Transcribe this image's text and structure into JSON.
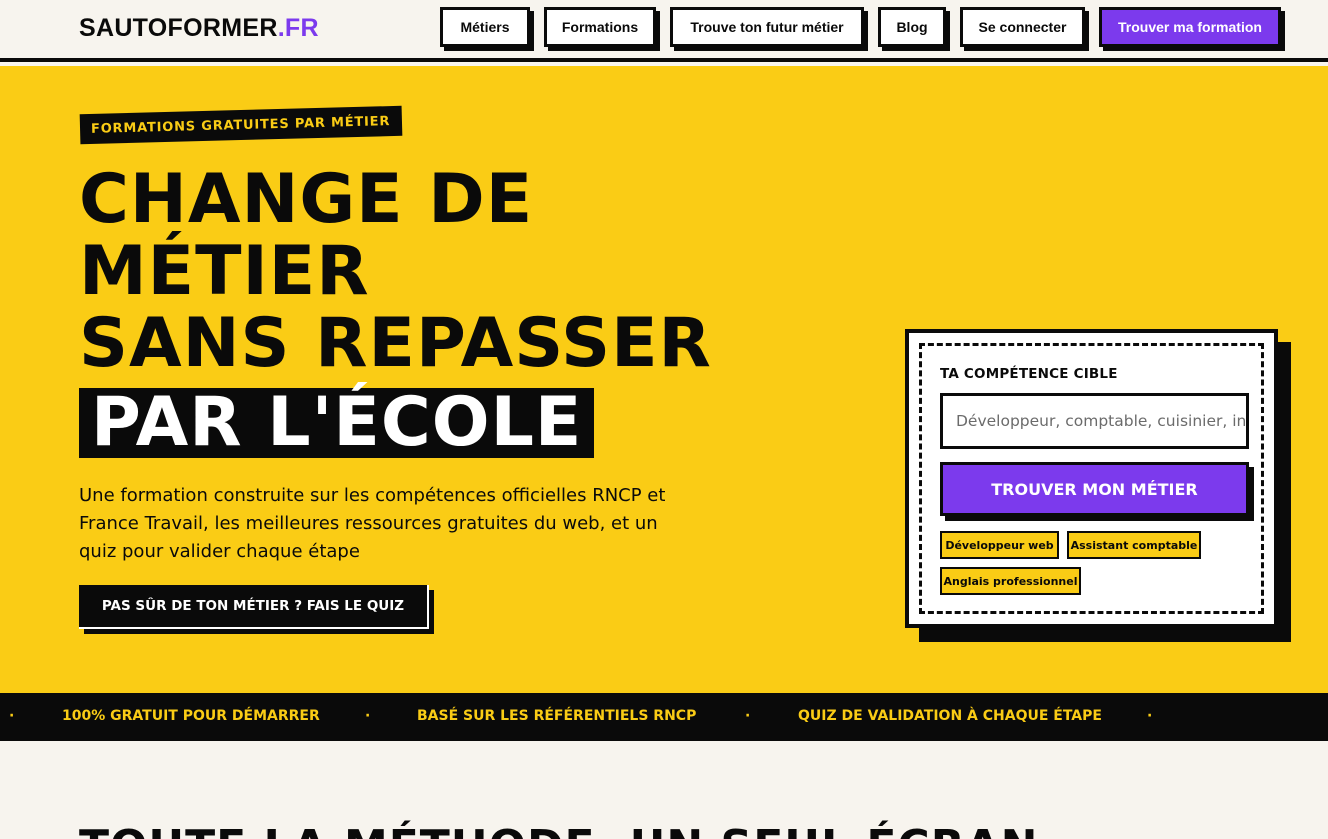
{
  "header": {
    "logo_main": "SAUTOFORMER",
    "logo_accent": ".FR",
    "nav": [
      {
        "label": "Métiers"
      },
      {
        "label": "Formations"
      },
      {
        "label": "Trouve ton futur métier"
      },
      {
        "label": "Blog"
      },
      {
        "label": "Se connecter"
      },
      {
        "label": "Trouver ma formation"
      }
    ]
  },
  "hero": {
    "tag": "FORMATIONS GRATUITES PAR MÉTIER",
    "headline": {
      "line1": "CHANGE DE",
      "line2": "MÉTIER",
      "line3": "SANS REPASSER",
      "line4": "PAR L'ÉCOLE"
    },
    "lead": "Une formation construite sur les compétences officielles RNCP et France Travail, les meilleures ressources gratuites du web, et un quiz pour valider chaque étape",
    "quiz_button": "PAS SÛR DE TON MÉTIER ? FAIS LE QUIZ"
  },
  "search_card": {
    "label": "TA COMPÉTENCE CIBLE",
    "input_value": "",
    "input_placeholder": "Développeur, comptable, cuisinier, infi",
    "button": "TROUVER MON MÉTIER",
    "chips": [
      {
        "label": "Développeur web"
      },
      {
        "label": "Assistant comptable"
      },
      {
        "label": "Anglais professionnel"
      }
    ]
  },
  "marquee": {
    "separator": "·",
    "items": [
      "100% GRATUIT POUR DÉMARRER",
      "BASÉ SUR LES RÉFÉRENTIELS RNCP",
      "QUIZ DE VALIDATION À CHAQUE ÉTAPE"
    ]
  },
  "section2": {
    "title": "TOUTE LA MÉTHODE, UN SEUL ÉCRAN"
  },
  "colors": {
    "yellow": "#facc15",
    "purple": "#7c3aed",
    "black": "#0a0a0a",
    "cream": "#f7f4ee"
  }
}
